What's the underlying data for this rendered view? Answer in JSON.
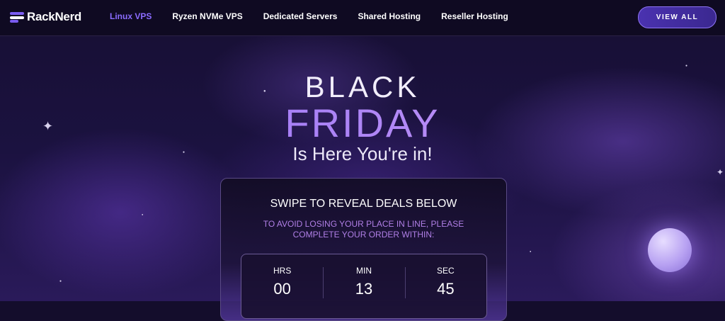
{
  "brand": {
    "name": "RackNerd"
  },
  "nav": {
    "items": [
      {
        "label": "Linux VPS",
        "active": true
      },
      {
        "label": "Ryzen NVMe VPS",
        "active": false
      },
      {
        "label": "Dedicated Servers",
        "active": false
      },
      {
        "label": "Shared Hosting",
        "active": false
      },
      {
        "label": "Reseller Hosting",
        "active": false
      }
    ],
    "cta_label": "VIEW ALL"
  },
  "hero": {
    "line1": "BLACK",
    "line2": "FRIDAY",
    "line3": "Is Here You're in!"
  },
  "card": {
    "title": "SWIPE TO REVEAL DEALS BELOW",
    "subtitle": "TO AVOID LOSING YOUR PLACE IN LINE, PLEASE COMPLETE YOUR ORDER WITHIN:",
    "timer": [
      {
        "label": "HRS",
        "value": "00"
      },
      {
        "label": "MIN",
        "value": "13"
      },
      {
        "label": "SEC",
        "value": "45"
      }
    ]
  },
  "colors": {
    "accent": "#8b6cff",
    "background": "#140d2c",
    "subtitle": "#b07fe6"
  },
  "icons": {
    "logo": "racknerd-logo-icon",
    "decor": "sparkle-star-icon"
  }
}
